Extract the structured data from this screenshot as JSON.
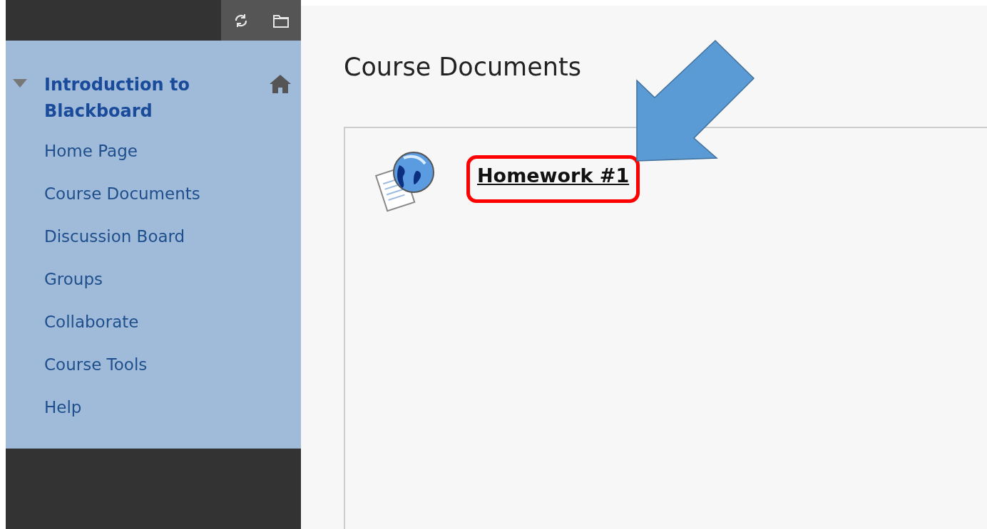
{
  "sidebar": {
    "course": {
      "title": "Introduction to Blackboard",
      "expanded": true
    },
    "items": [
      {
        "label": "Home Page"
      },
      {
        "label": "Course Documents"
      },
      {
        "label": "Discussion Board"
      },
      {
        "label": "Groups"
      },
      {
        "label": "Collaborate"
      },
      {
        "label": "Course Tools"
      },
      {
        "label": "Help"
      }
    ]
  },
  "content": {
    "title": "Course Documents",
    "items": [
      {
        "kind": "link",
        "title": "Homework #1",
        "highlighted": true
      }
    ]
  }
}
